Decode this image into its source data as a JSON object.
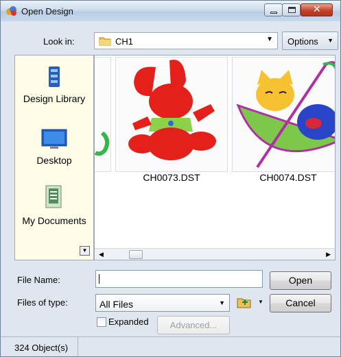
{
  "window": {
    "title": "Open Design"
  },
  "lookin": {
    "label": "Look in:",
    "folder": "CH1",
    "options_label": "Options"
  },
  "places": [
    {
      "label": "Design Library",
      "icon": "design-library-icon"
    },
    {
      "label": "Desktop",
      "icon": "desktop-icon"
    },
    {
      "label": "My Documents",
      "icon": "my-documents-icon"
    }
  ],
  "files": [
    {
      "name": "CH0073.DST"
    },
    {
      "name": "CH0074.DST"
    }
  ],
  "form": {
    "file_name_label": "File Name:",
    "file_name_value": "",
    "files_of_type_label": "Files of type:",
    "files_of_type_value": "All Files",
    "open_label": "Open",
    "cancel_label": "Cancel",
    "expanded_label": "Expanded",
    "expanded_checked": false,
    "advanced_label": "Advanced..."
  },
  "status": {
    "text": "324 Object(s)"
  }
}
